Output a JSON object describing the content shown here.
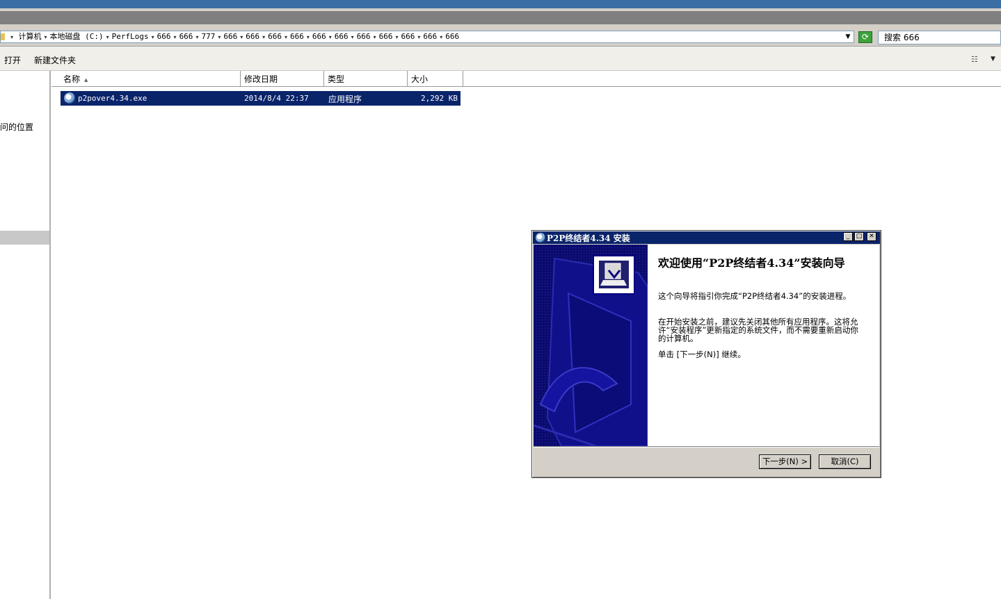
{
  "address": {
    "crumbs": [
      "计算机",
      "本地磁盘 (C:)",
      "PerfLogs",
      "666",
      "666",
      "777",
      "666",
      "666",
      "666",
      "666",
      "666",
      "666",
      "666",
      "666",
      "666",
      "666",
      "666"
    ]
  },
  "search": {
    "value": "搜索 666"
  },
  "toolbar": {
    "open_label": "打开",
    "new_folder_label": "新建文件夹"
  },
  "nav": {
    "partial_label": "问的位置"
  },
  "columns": {
    "name": "名称",
    "date": "修改日期",
    "type": "类型",
    "size": "大小"
  },
  "files": [
    {
      "name": "p2pover4.34.exe",
      "date": "2014/8/4 22:37",
      "type": "应用程序",
      "size": "2,292 KB"
    }
  ],
  "dialog": {
    "title": "P2P终结者4.34 安装",
    "heading": "欢迎使用“P2P终结者4.34”安装向导",
    "para1": "这个向导将指引你完成“P2P终结者4.34”的安装进程。",
    "para2": "在开始安装之前，建议先关闭其他所有应用程序。这将允许“安装程序”更新指定的系统文件，而不需要重新启动你的计算机。",
    "para3": "单击 [下一步(N)] 继续。",
    "next_label": "下一步(N) >",
    "cancel_label": "取消(C)"
  },
  "colors": {
    "selection": "#0a246a",
    "title_bar": "#0a246a",
    "top_band": "#3a6ea5"
  }
}
